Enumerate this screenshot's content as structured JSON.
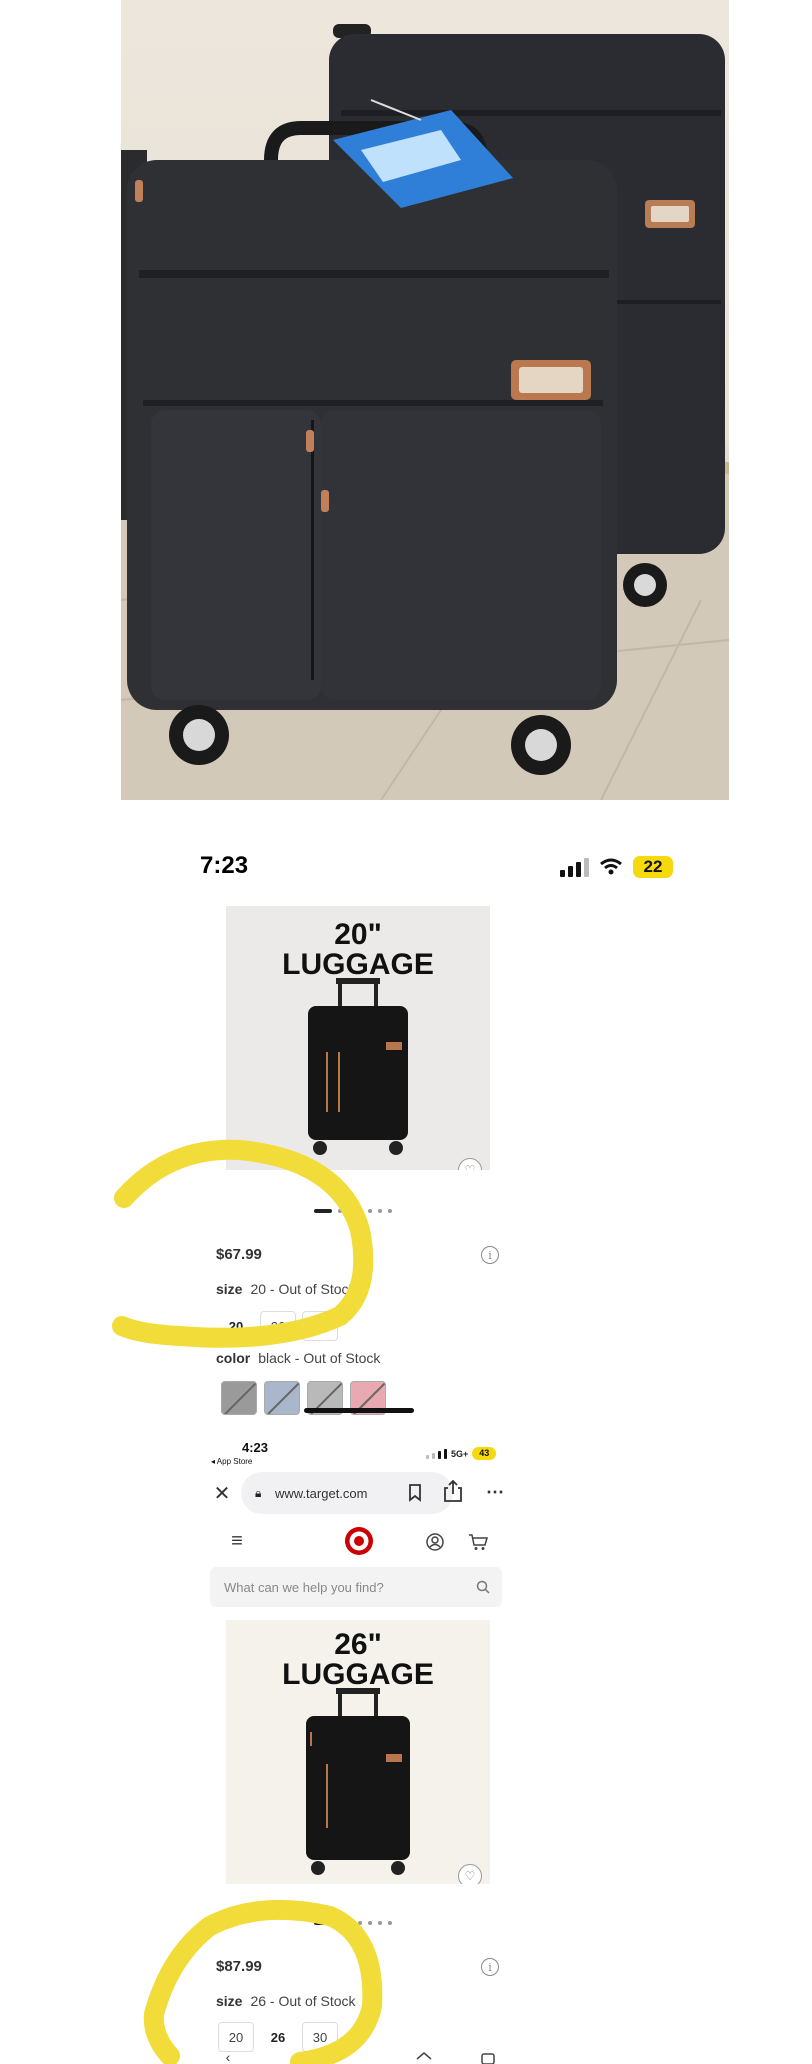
{
  "screenshot1": {
    "status": {
      "time": "7:23",
      "battery": "22"
    },
    "product": {
      "title_line1": "20\"",
      "title_line2": "LUGGAGE",
      "price": "$67.99",
      "size_label": "size",
      "size_value": "20 - Out of Stock",
      "size_options": [
        "20",
        "26",
        "30"
      ],
      "selected_size": "20",
      "color_label": "color",
      "color_value": "black - Out of Stock",
      "swatch_colors": [
        "#9a9a9a",
        "#a9b6cc",
        "#b9b9b9",
        "#e8a9b0"
      ]
    }
  },
  "screenshot2": {
    "status": {
      "time": "4:23",
      "back_app": "◂ App Store",
      "network": "5G+",
      "battery": "43"
    },
    "browser": {
      "url": "www.target.com"
    },
    "search": {
      "placeholder": "What can we help you find?"
    },
    "product": {
      "title_line1": "26\"",
      "title_line2": "LUGGAGE",
      "price": "$87.99",
      "size_label": "size",
      "size_value": "26 - Out of Stock",
      "size_options": [
        "20",
        "26",
        "30"
      ],
      "selected_size": "26"
    }
  },
  "colors": {
    "highlight": "#f2dc3a",
    "target_red": "#cc0000",
    "battery_yellow": "#f5d90a"
  },
  "icons": [
    "signal-icon",
    "wifi-icon",
    "heart-icon",
    "info-icon",
    "close-icon",
    "lock-icon",
    "bookmark-icon",
    "share-icon",
    "more-icon",
    "menu-icon",
    "target-logo-icon",
    "account-icon",
    "cart-icon",
    "search-icon",
    "back-icon",
    "forward-icon",
    "home-icon",
    "tabs-icon"
  ]
}
